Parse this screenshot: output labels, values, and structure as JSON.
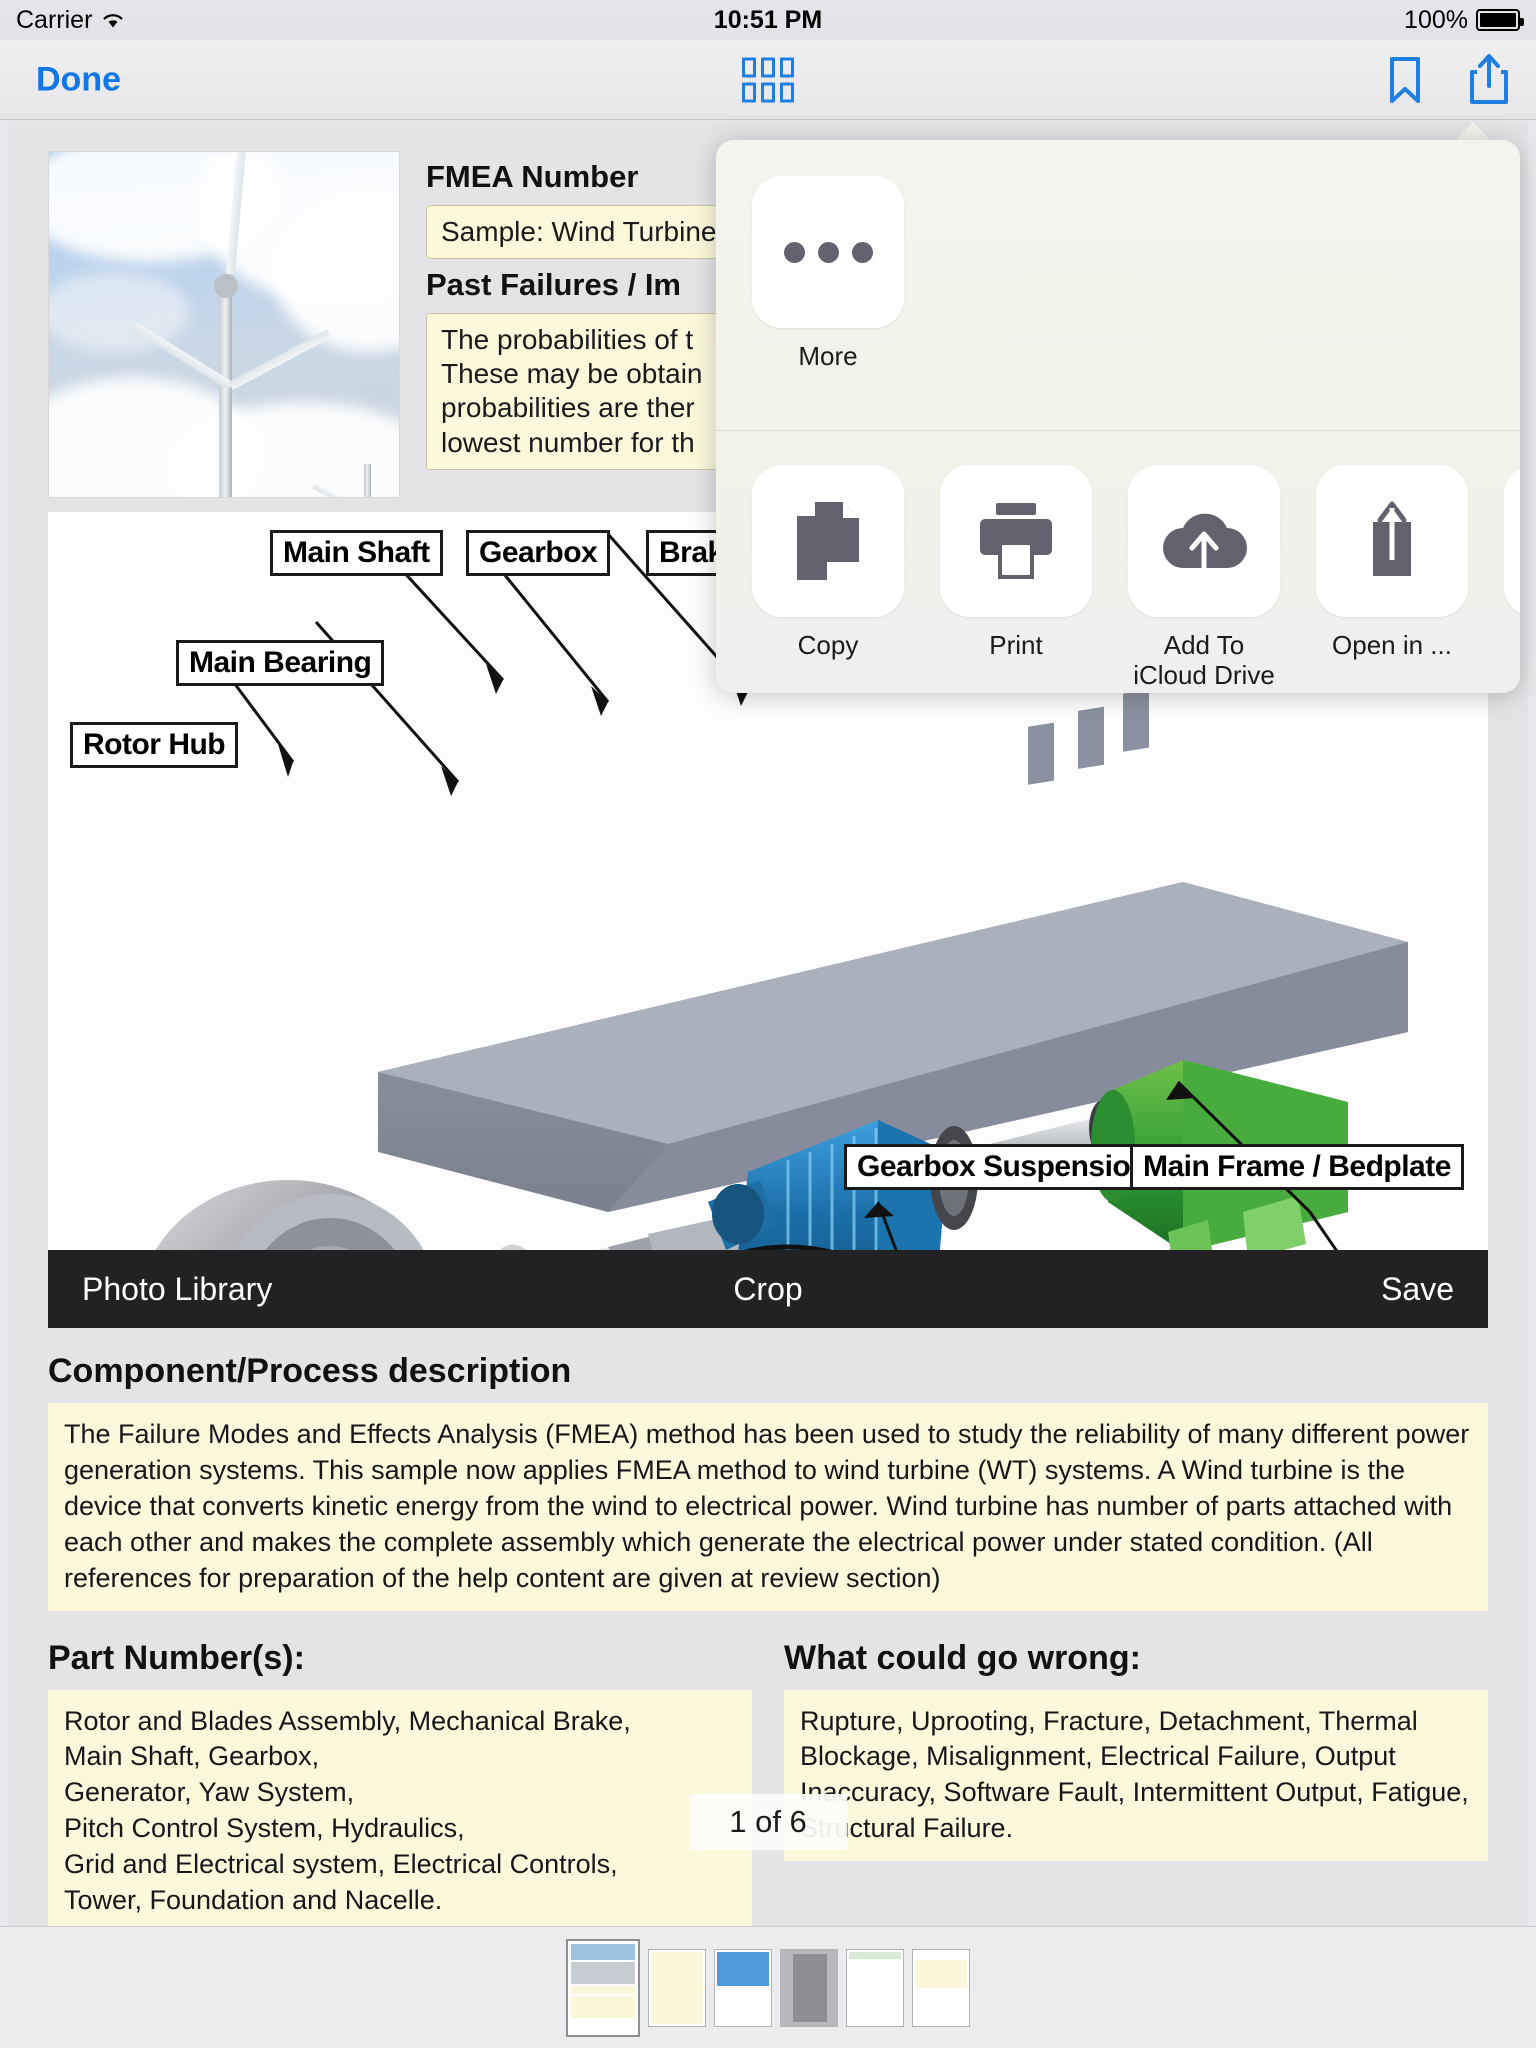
{
  "status_bar": {
    "carrier": "Carrier",
    "wifi_icon": "wifi-icon",
    "time": "10:51 PM",
    "battery_percent": "100%",
    "battery_icon": "battery-full-icon"
  },
  "nav_bar": {
    "done_label": "Done",
    "grid_icon": "grid-view-icon",
    "bookmark_icon": "bookmark-icon",
    "share_icon": "share-icon"
  },
  "document": {
    "photo_alt": "wind-turbine-photo",
    "fmea_number_label": "FMEA Number",
    "fmea_number_value": "Sample: Wind Turbine",
    "past_failures_label": "Past Failures / Im",
    "past_failures_value": "The probabilities of t\nThese may be obtain\nprobabilities are ther\nlowest number for th",
    "diagram_labels": [
      "Main Shaft",
      "Gearbox",
      "Brake",
      "Main Bearing",
      "Rotor Hub",
      "Gearbox Suspension",
      "Main Frame / Bedplate"
    ],
    "image_toolbar": {
      "photo_library": "Photo Library",
      "crop": "Crop",
      "save": "Save"
    },
    "component_description_title": "Component/Process description",
    "component_description_text": "The Failure Modes and Effects Analysis (FMEA) method has been used to study the reliability of many different power generation systems. This sample now applies FMEA method to wind turbine (WT) systems. A Wind turbine is the device that converts kinetic energy from the wind to electrical power. Wind turbine has number of parts attached with each other and makes the complete assembly which generate the electrical power under stated condition. (All references for preparation of the help content are given at review section)",
    "part_numbers_title": "Part Number(s):",
    "part_numbers_text": "Rotor and Blades Assembly, Mechanical Brake,\nMain Shaft, Gearbox,\nGenerator, Yaw System,\nPitch Control System, Hydraulics,\nGrid and Electrical system, Electrical Controls,\nTower, Foundation and Nacelle.",
    "what_could_go_wrong_title": "What could go wrong:",
    "what_could_go_wrong_text": "Rupture, Uprooting, Fracture, Detachment, Thermal Blockage, Misalignment, Electrical Failure, Output Inaccuracy, Software Fault, Intermittent Output, Fatigue, Structural Failure.",
    "page_indicator": "1 of 6"
  },
  "share_sheet": {
    "more": {
      "label": "More",
      "icon": "ellipsis-icon"
    },
    "actions": [
      {
        "label": "Copy",
        "icon": "copy-icon"
      },
      {
        "label": "Print",
        "icon": "printer-icon"
      },
      {
        "label": "Add To iCloud Drive",
        "icon": "icloud-upload-icon"
      },
      {
        "label": "Open in ...",
        "icon": "open-in-icon"
      }
    ]
  },
  "colors": {
    "accent_blue": "#1077e8",
    "note_yellow": "#fbf8dc",
    "toolbar_black": "#222224",
    "page_gray": "#e4e4e6"
  },
  "thumbnails": [
    {
      "name": "page-1-thumb",
      "selected": true
    },
    {
      "name": "page-2-thumb",
      "selected": false
    },
    {
      "name": "page-3-thumb",
      "selected": false
    },
    {
      "name": "page-4-thumb",
      "selected": false
    },
    {
      "name": "page-5-thumb",
      "selected": false
    },
    {
      "name": "page-6-thumb",
      "selected": false
    }
  ]
}
